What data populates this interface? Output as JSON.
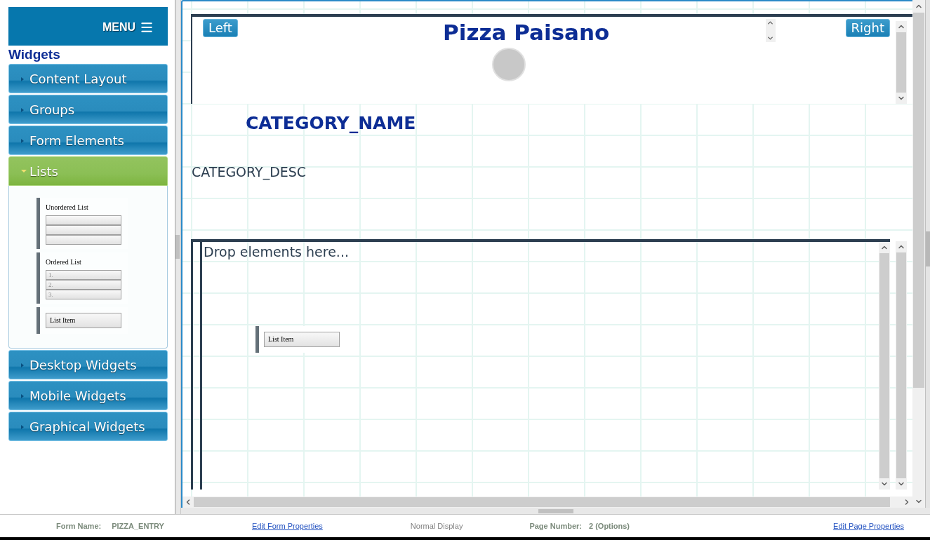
{
  "sidebar": {
    "menu_label": "MENU",
    "title": "Widgets",
    "sections": [
      {
        "label": "Content Layout",
        "expanded": false
      },
      {
        "label": "Groups",
        "expanded": false
      },
      {
        "label": "Form Elements",
        "expanded": false
      },
      {
        "label": "Lists",
        "expanded": true,
        "widgets": [
          {
            "kind": "unordered",
            "label": "Unordered List"
          },
          {
            "kind": "ordered",
            "label": "Ordered List",
            "items": [
              "1.",
              "2.",
              "3."
            ]
          },
          {
            "kind": "item",
            "label": "List Item"
          }
        ]
      },
      {
        "label": "Desktop Widgets",
        "expanded": false
      },
      {
        "label": "Mobile Widgets",
        "expanded": false
      },
      {
        "label": "Graphical Widgets",
        "expanded": false
      }
    ]
  },
  "canvas": {
    "header": {
      "left_button": "Left",
      "title": "Pizza Paisano",
      "right_button": "Right"
    },
    "category_name": "CATEGORY_NAME",
    "category_desc": "CATEGORY_DESC",
    "drop_zone": {
      "placeholder": "Drop elements here...",
      "items": [
        {
          "kind": "item",
          "label": "List Item"
        }
      ]
    }
  },
  "status_bar": {
    "form_name_label": "Form Name:",
    "form_name": "PIZZA_ENTRY",
    "edit_form_link": "Edit Form Properties",
    "display_mode": "Normal Display",
    "page_number_label": "Page Number:",
    "page_number": "2 (Options)",
    "edit_page_link": "Edit Page Properties"
  }
}
